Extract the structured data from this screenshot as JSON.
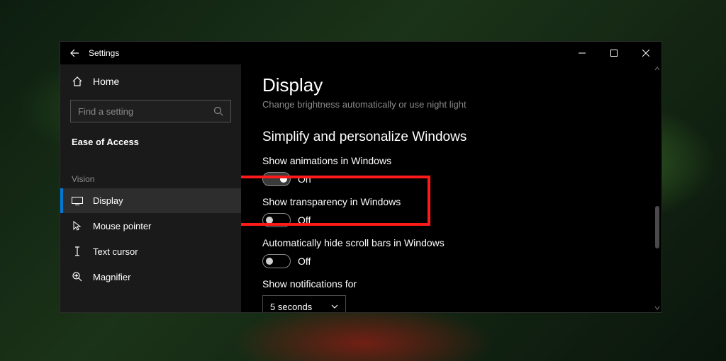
{
  "window": {
    "title": "Settings"
  },
  "sidebar": {
    "home_label": "Home",
    "search_placeholder": "Find a setting",
    "section": "Ease of Access",
    "group_label": "Vision",
    "items": [
      {
        "label": "Display",
        "active": true
      },
      {
        "label": "Mouse pointer",
        "active": false
      },
      {
        "label": "Text cursor",
        "active": false
      },
      {
        "label": "Magnifier",
        "active": false
      }
    ]
  },
  "page": {
    "title": "Display",
    "subtitle": "Change brightness automatically or use night light",
    "section_heading": "Simplify and personalize Windows"
  },
  "settings": {
    "animations": {
      "label": "Show animations in Windows",
      "state": "On",
      "on": true
    },
    "transparency": {
      "label": "Show transparency in Windows",
      "state": "Off",
      "on": false
    },
    "scrollbars": {
      "label": "Automatically hide scroll bars in Windows",
      "state": "Off",
      "on": false
    },
    "notifications": {
      "label": "Show notifications for",
      "value": "5 seconds"
    }
  }
}
